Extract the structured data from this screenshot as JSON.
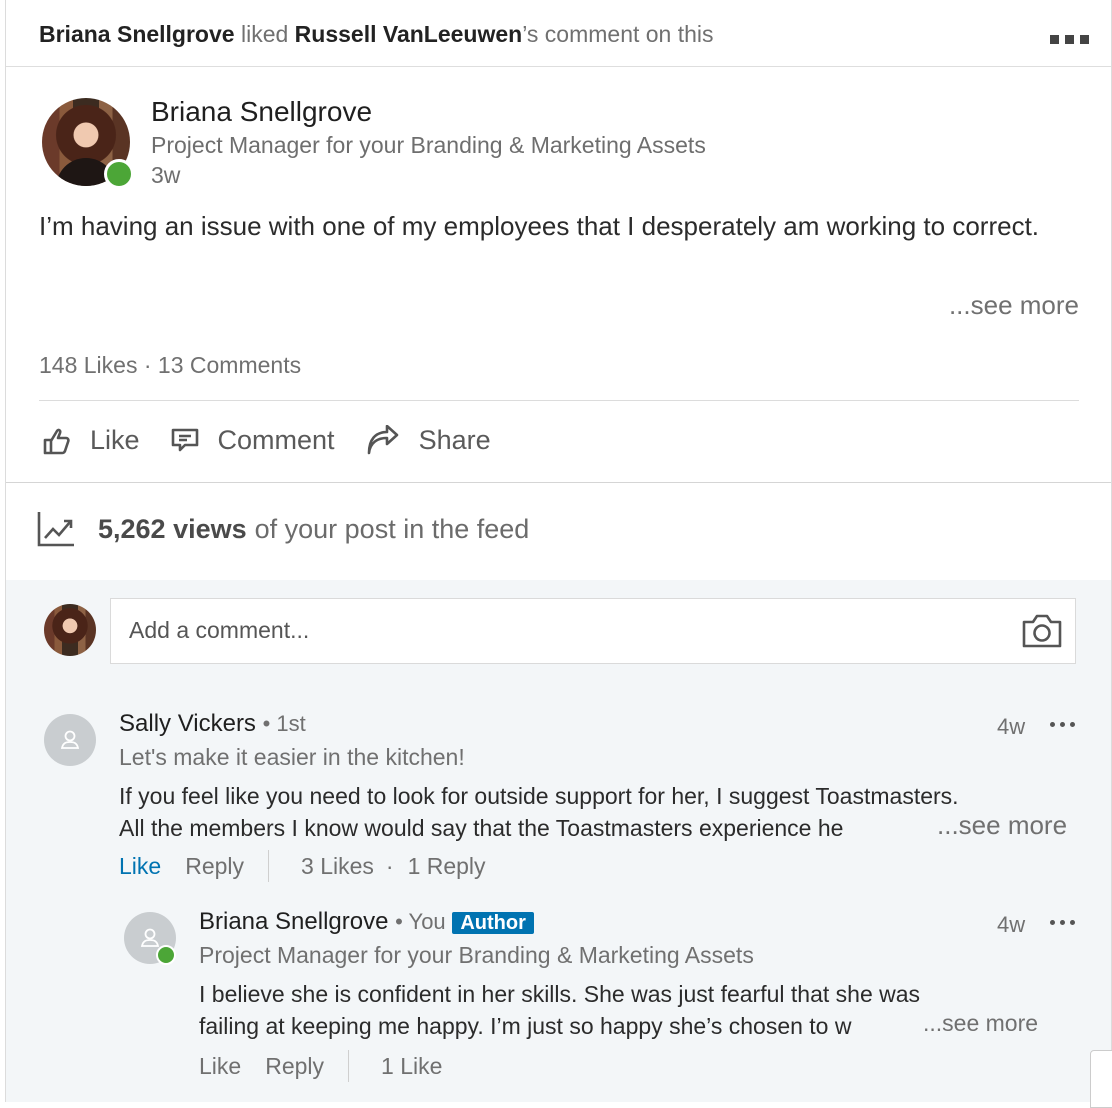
{
  "activity": {
    "actor": "Briana Snellgrove",
    "verb": "liked",
    "target": "Russell VanLeeuwen",
    "suffix": "’s comment on this"
  },
  "post": {
    "author_name": "Briana Snellgrove",
    "author_headline": "Project Manager for your Branding & Marketing Assets",
    "time": "3w",
    "text": "I’m having an issue with one of my employees that I desperately am working to correct.",
    "see_more": "...see more",
    "likes": "148 Likes",
    "separator": "·",
    "comments": "13 Comments"
  },
  "actions": {
    "like": "Like",
    "comment": "Comment",
    "share": "Share"
  },
  "views": {
    "count": "5,262 views",
    "suffix": "of your post in the feed"
  },
  "comment_box": {
    "placeholder": "Add a comment..."
  },
  "comments": [
    {
      "name": "Sally Vickers",
      "degree": "• 1st",
      "headline": "Let's make it easier in the kitchen!",
      "time": "4w",
      "line1": "If you feel like you need to look for outside support for her, I suggest Toastmasters.",
      "line2": "All the members I know would say that the Toastmasters experience he",
      "see_more": "...see more",
      "like": "Like",
      "reply": "Reply",
      "likes": "3 Likes",
      "dot": "·",
      "replies": "1 Reply"
    }
  ],
  "reply": {
    "name": "Briana Snellgrove",
    "you": "• You",
    "badge": "Author",
    "headline": "Project Manager for your Branding & Marketing Assets",
    "time": "4w",
    "line1": "I believe she is confident in her skills. She was just fearful that she was",
    "line2": "failing at keeping me happy. I’m just so happy she’s chosen to w",
    "see_more": "...see more",
    "like": "Like",
    "reply": "Reply",
    "likes": "1 Like"
  },
  "colors": {
    "accent": "#0073b1",
    "online": "#4ca637",
    "comment_bg": "#f3f6f8"
  }
}
